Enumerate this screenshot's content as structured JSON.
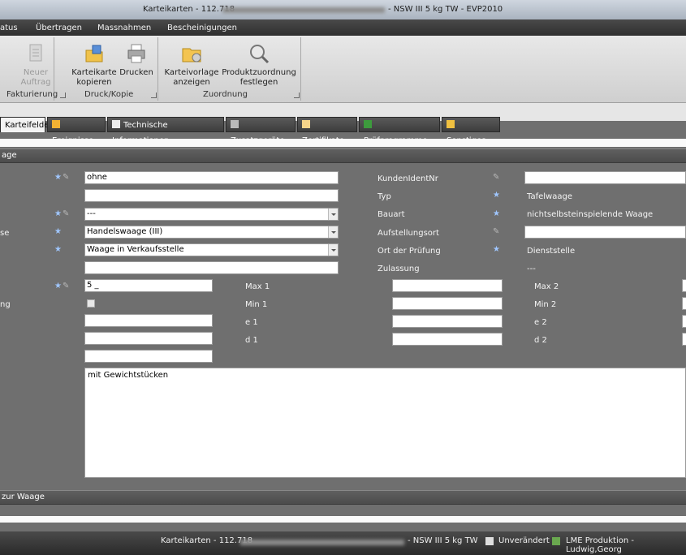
{
  "window": {
    "title_prefix": "Karteikarten - 112.718",
    "title_suffix": "- NSW III 5 kg TW - EVP2010"
  },
  "menu": [
    "atus",
    "Übertragen",
    "Massnahmen",
    "Bescheinigungen"
  ],
  "ribbon": {
    "groups": [
      {
        "label": "Fakturierung",
        "buttons": [
          {
            "label_line1": "Neuer",
            "label_line2": "Auftrag",
            "icon": "new-order-icon",
            "enabled": false
          }
        ]
      },
      {
        "label": "Druck/Kopie",
        "buttons": [
          {
            "label_line1": "Karteikarte",
            "label_line2": "kopieren",
            "icon": "copy-card-icon"
          },
          {
            "label_line1": "Drucken",
            "label_line2": "",
            "icon": "printer-icon"
          }
        ]
      },
      {
        "label": "Zuordnung",
        "buttons": [
          {
            "label_line1": "Karteivorlage",
            "label_line2": "anzeigen",
            "icon": "template-folder-icon"
          },
          {
            "label_line1": "Produktzuordnung",
            "label_line2": "festlegen",
            "icon": "magnifier-icon"
          }
        ]
      }
    ]
  },
  "tabs": [
    "Karteifelder",
    "Ereignisse",
    "Technische Informationen",
    "Zusatzgeräte",
    "Zertifikate",
    "Prüfprogramme",
    "Sonstiges"
  ],
  "section1": {
    "label": "age"
  },
  "left_labels": {
    "row4": "se",
    "row8": "ng"
  },
  "left_fields": {
    "f1": "ohne",
    "f2": "",
    "f3": "---",
    "f4": "Handelswaage (III)",
    "f5": "Waage in Verkaufsstelle",
    "f6": "",
    "f7": "5 _",
    "f9": "",
    "f10": "",
    "f11": ""
  },
  "right_labels": {
    "kunden": "KundenIdentNr",
    "typ": "Typ",
    "bauart": "Bauart",
    "aufstellungsort": "Aufstellungsort",
    "ort_pruefung": "Ort der Prüfung",
    "zulassung": "Zulassung"
  },
  "right_values": {
    "kunden": "",
    "typ": "Tafelwaage",
    "bauart": "nichtselbsteinspielende Waage",
    "aufstellungsort": "",
    "ort_pruefung": "Dienststelle",
    "zulassung": "---"
  },
  "mid_labels": {
    "max1": "Max 1",
    "min1": "Min 1",
    "e1": "e 1",
    "d1": "d 1",
    "max2": "Max 2",
    "min2": "Min 2",
    "e2": "e 2",
    "d2": "d 2"
  },
  "notes": "mit Gewichtstücken",
  "section2": {
    "label": "zur Waage"
  },
  "status": {
    "title_prefix": "Karteikarten - 112.718",
    "title_suffix": "- NSW III 5 kg TW",
    "state": "Unverändert",
    "user": "LME Produktion - Ludwig,Georg"
  }
}
